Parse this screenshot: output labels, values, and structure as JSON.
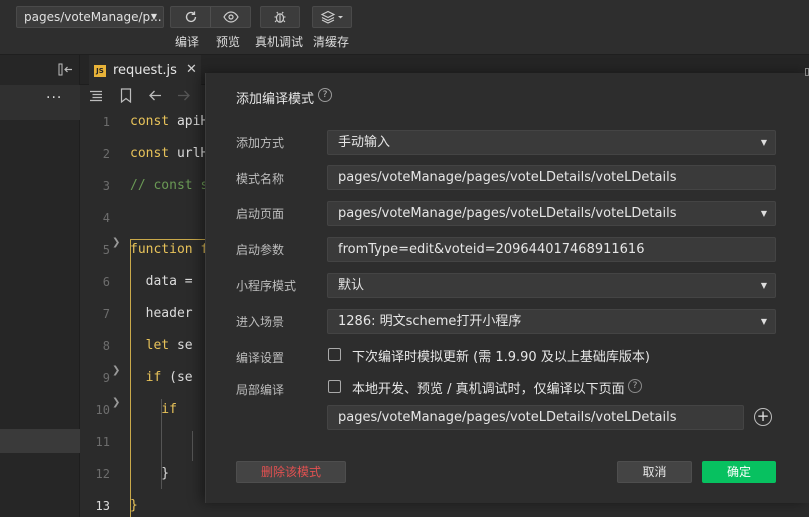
{
  "toolbar": {
    "page_select": "pages/voteManage/p...",
    "compile_label": "编译",
    "preview_label": "预览",
    "remote_debug_label": "真机调试",
    "clear_cache_label": "清缓存"
  },
  "editor": {
    "tab_name": "request.js",
    "tab_icon_text": "JS",
    "line_numbers": [
      "1",
      "2",
      "3",
      "4",
      "5",
      "6",
      "7",
      "8",
      "9",
      "10",
      "11",
      "12",
      "13"
    ],
    "lines": {
      "l1_kw": "const",
      "l1_rest": " apiH",
      "l2_kw": "const",
      "l2_rest": " urlH",
      "l3": "// const s",
      "l5_kw": "function",
      "l5_rest": " f",
      "l6": "  data =",
      "l7": "  header",
      "l8_kw": "  let",
      "l8_rest": " se",
      "l9_kw": "  if",
      "l9_rest": " (se",
      "l10": "    if",
      "l12": "    }",
      "l13": "}"
    },
    "current_line": "13"
  },
  "modal": {
    "title": "添加编译模式",
    "fields": {
      "add_mode_label": "添加方式",
      "add_mode_value": "手动输入",
      "mode_name_label": "模式名称",
      "mode_name_value": "pages/voteManage/pages/voteLDetails/voteLDetails",
      "start_page_label": "启动页面",
      "start_page_value": "pages/voteManage/pages/voteLDetails/voteLDetails",
      "start_params_label": "启动参数",
      "start_params_value": "fromType=edit&voteid=209644017468911616",
      "mp_mode_label": "小程序模式",
      "mp_mode_value": "默认",
      "scene_label": "进入场景",
      "scene_value": "1286: 明文scheme打开小程序",
      "compile_settings_label": "编译设置",
      "compile_settings_check": "下次编译时模拟更新 (需 1.9.90 及以上基础库版本)",
      "partial_compile_label": "局部编译",
      "partial_compile_check": "本地开发、预览 / 真机调试时，仅编译以下页面",
      "partial_page_value": "pages/voteManage/pages/voteLDetails/voteLDetails"
    },
    "buttons": {
      "delete": "删除该模式",
      "cancel": "取消",
      "ok": "确定"
    }
  },
  "colors": {
    "accent_green": "#07c160",
    "danger_red": "#e35151",
    "keyword_yellow": "#e8c35a"
  }
}
